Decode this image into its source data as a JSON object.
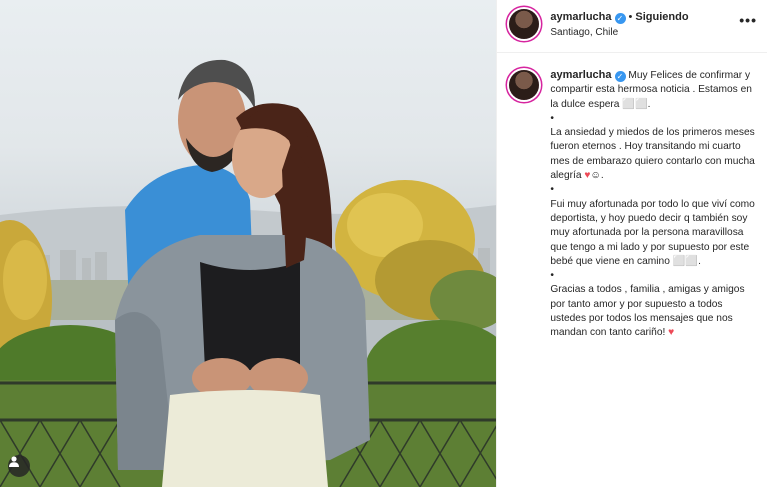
{
  "post": {
    "username": "aymarlucha",
    "verified_mark": "✓",
    "separator": "•",
    "follow_label": "Siguiendo",
    "location": "Santiago, Chile",
    "more_icon": "•••",
    "more_icon_name": "more-options-icon",
    "user_tag_icon_name": "user-tag-icon",
    "verified_color": "#3897f0",
    "heart_color": "#ed4956"
  },
  "caption": {
    "username": "aymarlucha",
    "p1": "Muy Felices de confirmar y compartir esta hermosa noticia . Estamos en la dulce espera ⬜⬜.",
    "b1": "•",
    "p2_text": "La ansiedad y miedos de los primeros meses fueron eternos . Hoy transitando mi cuarto mes de embarazo quiero contarlo con mucha alegría",
    "p2_end": "☺.",
    "b2": "•",
    "p3": "Fui muy afortunada por todo lo que viví como deportista, y hoy puedo decir q también soy muy afortunada por la persona maravillosa que tengo a mi lado y por supuesto por este bebé que viene en camino ⬜⬜.",
    "b3": "•",
    "p4_text": "Gracias a todos , familia , amigas y amigos por tanto amor y por supuesto a todos ustedes por todos los mensajes que nos mandan con tanto cariño!",
    "heart": "♥"
  }
}
